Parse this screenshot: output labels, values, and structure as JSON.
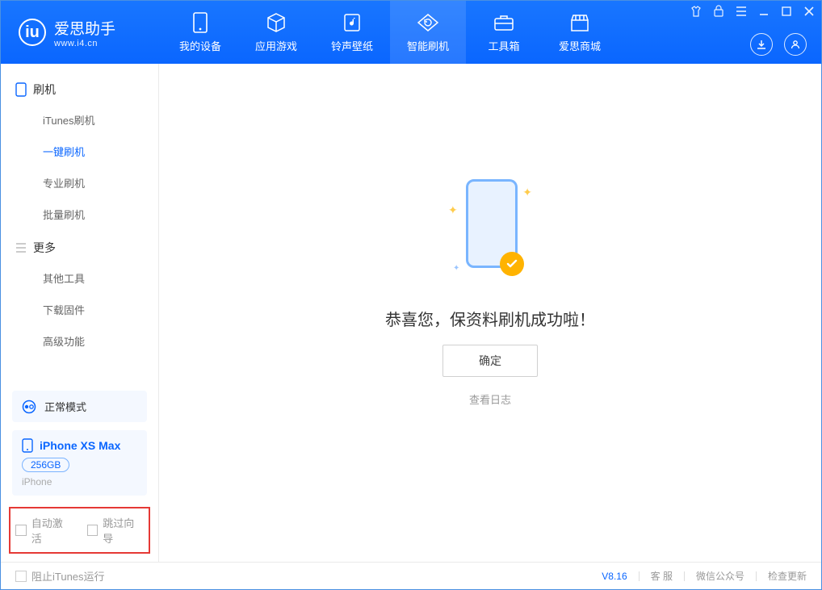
{
  "app": {
    "name_cn": "爱思助手",
    "url": "www.i4.cn",
    "logo_letter": "iu"
  },
  "nav": {
    "items": [
      {
        "label": "我的设备",
        "icon": "device-icon"
      },
      {
        "label": "应用游戏",
        "icon": "cube-icon"
      },
      {
        "label": "铃声壁纸",
        "icon": "music-icon"
      },
      {
        "label": "智能刷机",
        "icon": "refresh-icon",
        "active": true
      },
      {
        "label": "工具箱",
        "icon": "toolbox-icon"
      },
      {
        "label": "爱思商城",
        "icon": "shop-icon"
      }
    ]
  },
  "sidebar": {
    "section1": {
      "title": "刷机"
    },
    "items1": [
      {
        "label": "iTunes刷机"
      },
      {
        "label": "一键刷机",
        "active": true
      },
      {
        "label": "专业刷机"
      },
      {
        "label": "批量刷机"
      }
    ],
    "section2": {
      "title": "更多"
    },
    "items2": [
      {
        "label": "其他工具"
      },
      {
        "label": "下载固件"
      },
      {
        "label": "高级功能"
      }
    ],
    "mode_label": "正常模式",
    "device": {
      "name": "iPhone XS Max",
      "capacity": "256GB",
      "type": "iPhone"
    },
    "opt_auto_activate": "自动激活",
    "opt_skip_wizard": "跳过向导"
  },
  "main": {
    "success_text": "恭喜您，保资料刷机成功啦！",
    "ok_button": "确定",
    "view_log": "查看日志"
  },
  "footer": {
    "block_itunes": "阻止iTunes运行",
    "version": "V8.16",
    "service": "客 服",
    "wechat": "微信公众号",
    "check_update": "检查更新"
  }
}
